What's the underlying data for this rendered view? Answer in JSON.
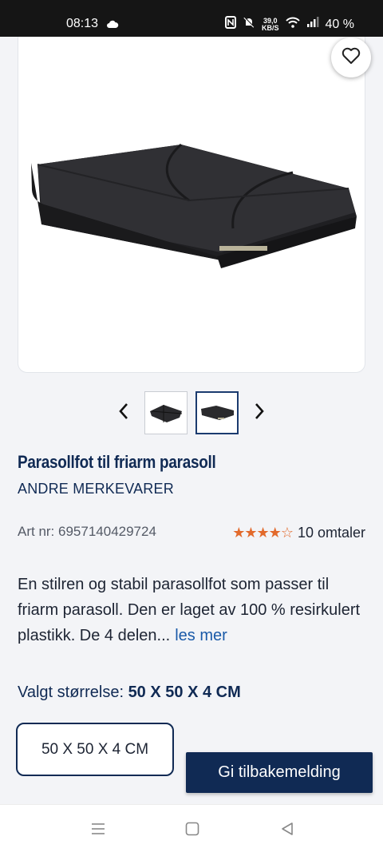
{
  "status_bar": {
    "time": "08:13",
    "speed_value": "39,0",
    "speed_unit": "KB/S",
    "battery": "40 %"
  },
  "product": {
    "title": "Parasollfot til friarm parasoll",
    "brand": "ANDRE MERKEVARER",
    "article": "Art nr: 6957140429724",
    "rating": 4,
    "rating_max": 5,
    "reviews": "10 omtaler",
    "description": "En stilren og stabil parasollfot som passer til friarm parasoll. Den er laget av 100 % resirkulert plastikk. De 4 delen...",
    "read_more": "les mer",
    "size_label": "Valgt størrelse:",
    "size_value": "50 X 50 X 4 CM",
    "size_options": [
      "50 X 50 X 4 CM"
    ]
  },
  "feedback_button": "Gi tilbakemelding",
  "icons": {
    "favorite": "heart-icon",
    "prev": "chevron-left-icon",
    "next": "chevron-right-icon",
    "recent": "menu-lines-icon",
    "home": "square-icon",
    "back": "triangle-back-icon"
  },
  "colors": {
    "brand_navy": "#102a54",
    "star_orange": "#e26a2c",
    "link_blue": "#1a5aa8"
  }
}
